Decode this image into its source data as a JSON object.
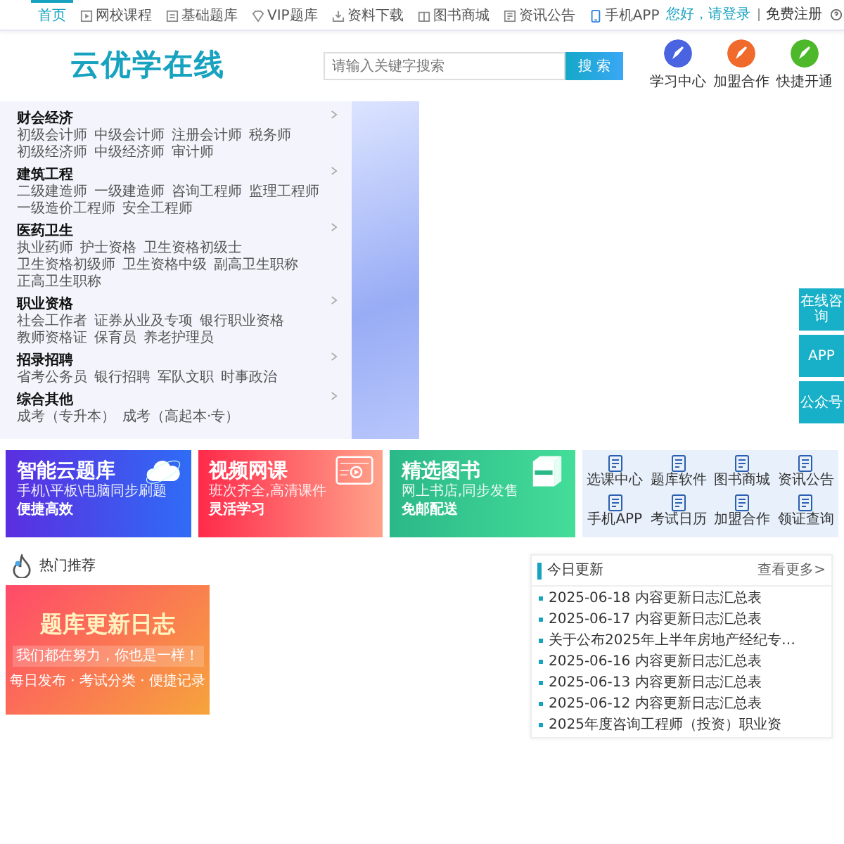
{
  "top_nav": {
    "items": [
      {
        "label": "首页",
        "selected": true
      },
      {
        "label": "网校课程",
        "selected": false
      },
      {
        "label": "基础题库",
        "selected": false
      },
      {
        "label": "VIP题库",
        "selected": false
      },
      {
        "label": "资料下载",
        "selected": false
      },
      {
        "label": "图书商城",
        "selected": false
      },
      {
        "label": "资讯公告",
        "selected": false
      },
      {
        "label": "手机APP",
        "selected": false
      }
    ],
    "login": "您好，请登录",
    "register": "免费注册"
  },
  "header": {
    "logo": "云优学在线",
    "search": {
      "placeholder": "请输入关键字搜索",
      "button": "搜 索"
    },
    "shortcuts": [
      {
        "label": "学习中心",
        "color": "#4a63e0"
      },
      {
        "label": "加盟合作",
        "color": "#f06a2c"
      },
      {
        "label": "快捷开通",
        "color": "#4cb82a"
      }
    ]
  },
  "category_menu": [
    {
      "title": "财会经济",
      "links": [
        "初级会计师",
        "中级会计师",
        "注册会计师",
        "税务师",
        "初级经济师",
        "中级经济师",
        "审计师"
      ]
    },
    {
      "title": "建筑工程",
      "links": [
        "二级建造师",
        "一级建造师",
        "咨询工程师",
        "监理工程师",
        "一级造价工程师",
        "安全工程师"
      ]
    },
    {
      "title": "医药卫生",
      "links": [
        "执业药师",
        "护士资格",
        "卫生资格初级士",
        "卫生资格初级师",
        "卫生资格中级",
        "副高卫生职称",
        "正高卫生职称"
      ]
    },
    {
      "title": "职业资格",
      "links": [
        "社会工作者",
        "证券从业及专项",
        "银行职业资格",
        "教师资格证",
        "保育员",
        "养老护理员"
      ]
    },
    {
      "title": "招录招聘",
      "links": [
        "省考公务员",
        "银行招聘",
        "军队文职",
        "时事政治"
      ]
    },
    {
      "title": "综合其他",
      "links": [
        "成考（专升本）",
        "成考（高起本·专）"
      ]
    }
  ],
  "side_float": [
    "在线咨询",
    "APP",
    "公众号"
  ],
  "feature_banners": [
    {
      "title": "智能云题库",
      "subtitle": "手机\\平板\\电脑同步刷题",
      "tagline": "便捷高效",
      "color": "#5b2ee0"
    },
    {
      "title": "视频网课",
      "subtitle": "班次齐全,高清课件",
      "tagline": "灵活学习",
      "color": "#ff2a4a"
    },
    {
      "title": "精选图书",
      "subtitle": "网上书店,同步发售",
      "tagline": "免邮配送",
      "color": "#2bb888"
    }
  ],
  "quick_links": [
    "选课中心",
    "题库软件",
    "图书商城",
    "资讯公告",
    "手机APP",
    "考试日历",
    "加盟合作",
    "领证查询"
  ],
  "hot": {
    "title": "热门推荐",
    "promo": {
      "title": "题库更新日志",
      "slogan": "我们都在努力，你也是一样！",
      "tags": "每日发布 · 考试分类 · 便捷记录"
    }
  },
  "news": {
    "title": "今日更新",
    "more": "查看更多>",
    "items": [
      "2025-06-18 内容更新日志汇总表",
      "2025-06-17 内容更新日志汇总表",
      "关于公布2025年上半年房地产经纪专…",
      "2025-06-16 内容更新日志汇总表",
      "2025-06-13 内容更新日志汇总表",
      "2025-06-12 内容更新日志汇总表",
      "2025年度咨询工程师（投资）职业资"
    ]
  }
}
